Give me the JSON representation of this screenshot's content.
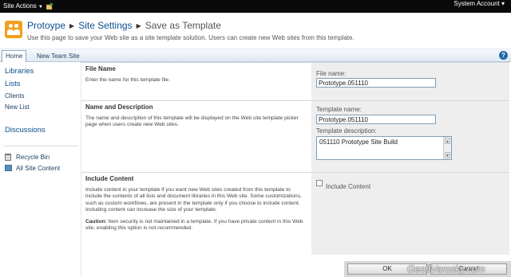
{
  "topbar": {
    "site_actions_label": "Site Actions",
    "account_label": "System Account ▾"
  },
  "header": {
    "crumbs": [
      "Protoype",
      "Site Settings",
      "Save as Template"
    ],
    "description": "Use this page to save your Web site as a site template solution. Users can create new Web sites from this template."
  },
  "topnav": {
    "tabs": [
      "Home",
      "New Team Site"
    ],
    "help_label": "?"
  },
  "leftnav": {
    "libraries": "Libraries",
    "lists": "Lists",
    "clients": "Clients",
    "new_list": "New List",
    "discussions": "Discussions",
    "recycle_bin": "Recycle Bin",
    "all_site_content": "All Site Content"
  },
  "sections": {
    "file_name": {
      "title": "File Name",
      "text": "Enter the name for this template file.",
      "field_label": "File name:",
      "value": "Prototype.051110"
    },
    "name_desc": {
      "title": "Name and Description",
      "text": "The name and description of this template will be displayed on the Web site template picker page when users create new Web sites.",
      "name_label": "Template name:",
      "name_value": "Prototype.051110",
      "desc_label": "Template description:",
      "desc_value": "051110 Prototype Site Build"
    },
    "include_content": {
      "title": "Include Content",
      "text": "Include content in your template if you want new Web sites created from this template to include the contents of all lists and document libraries in this Web site. Some customizations, such as custom workflows, are present in the template only if you choose to include content. Including content can increase the size of your template.",
      "caution_label": "Caution:",
      "caution_text": " Item security is not maintained in a template. If you have private content in this Web site, enabling this option is not recommended.",
      "checkbox_label": "Include Content",
      "checked": false
    }
  },
  "buttons": {
    "ok": "OK",
    "cancel": "Cancel"
  },
  "watermark": "GeoffVarosky.com",
  "colors": {
    "link": "#0b4f8e",
    "logo": "#f0a020",
    "topbar": "#0a0a0a"
  }
}
